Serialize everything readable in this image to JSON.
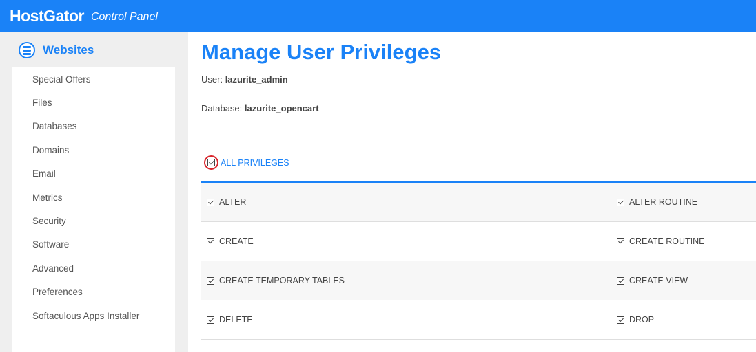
{
  "header": {
    "brand": "HostGator",
    "subtitle": "Control Panel"
  },
  "sidebar": {
    "section_title": "Websites",
    "items": [
      {
        "label": "Special Offers"
      },
      {
        "label": "Files"
      },
      {
        "label": "Databases"
      },
      {
        "label": "Domains"
      },
      {
        "label": "Email"
      },
      {
        "label": "Metrics"
      },
      {
        "label": "Security"
      },
      {
        "label": "Software"
      },
      {
        "label": "Advanced"
      },
      {
        "label": "Preferences"
      },
      {
        "label": "Softaculous Apps Installer"
      }
    ]
  },
  "main": {
    "title": "Manage User Privileges",
    "user_label": "User:",
    "user_value": "lazurite_admin",
    "database_label": "Database:",
    "database_value": "lazurite_opencart",
    "all_privileges": "ALL PRIVILEGES",
    "rows": [
      {
        "left": "ALTER",
        "right": "ALTER ROUTINE"
      },
      {
        "left": "CREATE",
        "right": "CREATE ROUTINE"
      },
      {
        "left": "CREATE TEMPORARY TABLES",
        "right": "CREATE VIEW"
      },
      {
        "left": "DELETE",
        "right": "DROP"
      }
    ]
  },
  "colors": {
    "accent": "#1a82f7",
    "highlight_ring": "#d9262c"
  }
}
